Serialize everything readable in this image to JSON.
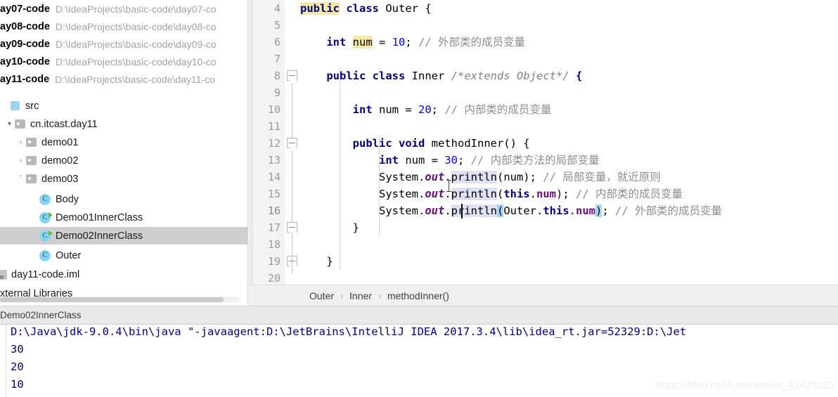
{
  "project_tree": {
    "modules": [
      {
        "name": "ay07-code",
        "path": "D:\\IdeaProjects\\basic-code\\day07-co"
      },
      {
        "name": "ay08-code",
        "path": "D:\\IdeaProjects\\basic-code\\day08-co"
      },
      {
        "name": "ay09-code",
        "path": "D:\\IdeaProjects\\basic-code\\day09-co"
      },
      {
        "name": "ay10-code",
        "path": "D:\\IdeaProjects\\basic-code\\day10-co"
      },
      {
        "name": "ay11-code",
        "path": "D:\\IdeaProjects\\basic-code\\day11-co"
      }
    ],
    "nodes": [
      {
        "label": "src",
        "icon": "source-root-icon"
      },
      {
        "label": "cn.itcast.day11",
        "icon": "package-icon",
        "arrow": "▾"
      },
      {
        "label": "demo01",
        "icon": "package-icon",
        "arrow": "›"
      },
      {
        "label": "demo02",
        "icon": "package-icon",
        "arrow": "›"
      },
      {
        "label": "demo03",
        "icon": "package-icon",
        "arrow": "ˇ"
      },
      {
        "label": "Body",
        "icon": "java-class-icon",
        "badge": "C"
      },
      {
        "label": "Demo01InnerClass",
        "icon": "java-class-runnable-icon",
        "badge": "C"
      },
      {
        "label": "Demo02InnerClass",
        "icon": "java-class-runnable-icon",
        "badge": "C",
        "selected": true
      },
      {
        "label": "Outer",
        "icon": "java-class-icon",
        "badge": "C"
      },
      {
        "label": "day11-code.iml",
        "icon": "iml-file-icon"
      },
      {
        "label": "xternal Libraries",
        "icon": "external-libraries-icon"
      }
    ]
  },
  "run_tab": {
    "label": "Demo02InnerClass"
  },
  "editor": {
    "first_line": 4,
    "current_line": 16,
    "line_numbers": [
      4,
      5,
      6,
      7,
      8,
      9,
      10,
      11,
      12,
      13,
      14,
      15,
      16,
      17,
      18,
      19,
      20
    ],
    "lines": [
      {
        "n": 4,
        "text": "public class Outer {"
      },
      {
        "n": 5,
        "text": ""
      },
      {
        "n": 6,
        "text": "    int num = 10; // 外部类的成员变量"
      },
      {
        "n": 7,
        "text": ""
      },
      {
        "n": 8,
        "text": "    public class Inner /*extends Object*/ {"
      },
      {
        "n": 9,
        "text": ""
      },
      {
        "n": 10,
        "text": "        int num = 20; // 内部类的成员变量"
      },
      {
        "n": 11,
        "text": ""
      },
      {
        "n": 12,
        "text": "        public void methodInner() {"
      },
      {
        "n": 13,
        "text": "            int num = 30; // 内部类方法的局部变量"
      },
      {
        "n": 14,
        "text": "            System.out.println(num); // 局部变量，就近原则"
      },
      {
        "n": 15,
        "text": "            System.out.println(this.num); // 内部类的成员变量"
      },
      {
        "n": 16,
        "text": "            System.out.println(Outer.this.num); // 外部类的成员变量"
      },
      {
        "n": 17,
        "text": "        }"
      },
      {
        "n": 18,
        "text": ""
      },
      {
        "n": 19,
        "text": "    }"
      },
      {
        "n": 20,
        "text": ""
      }
    ]
  },
  "breadcrumb": {
    "items": [
      "Outer",
      "Inner",
      "methodInner()"
    ],
    "separator": "›"
  },
  "console": {
    "lines": [
      "D:\\Java\\jdk-9.0.4\\bin\\java \"-javaagent:D:\\JetBrains\\IntelliJ IDEA 2017.3.4\\lib\\idea_rt.jar=52329:D:\\Jet",
      "30",
      "20",
      "10"
    ]
  },
  "watermark": {
    "text": "https://blog.csdn.net/weixin_43428283"
  },
  "colors": {
    "keyword": "#000080",
    "number": "#0000ff",
    "comment": "#8c8c8c",
    "field": "#660e7a",
    "current_line_bg": "#fcf9e4",
    "usage_highlight": "#dfdff5",
    "identifier_highlight": "#f7e8a6",
    "brace_match": "#a7d5f5",
    "selection_row": "#cfcfcf",
    "console_text": "#000080"
  }
}
